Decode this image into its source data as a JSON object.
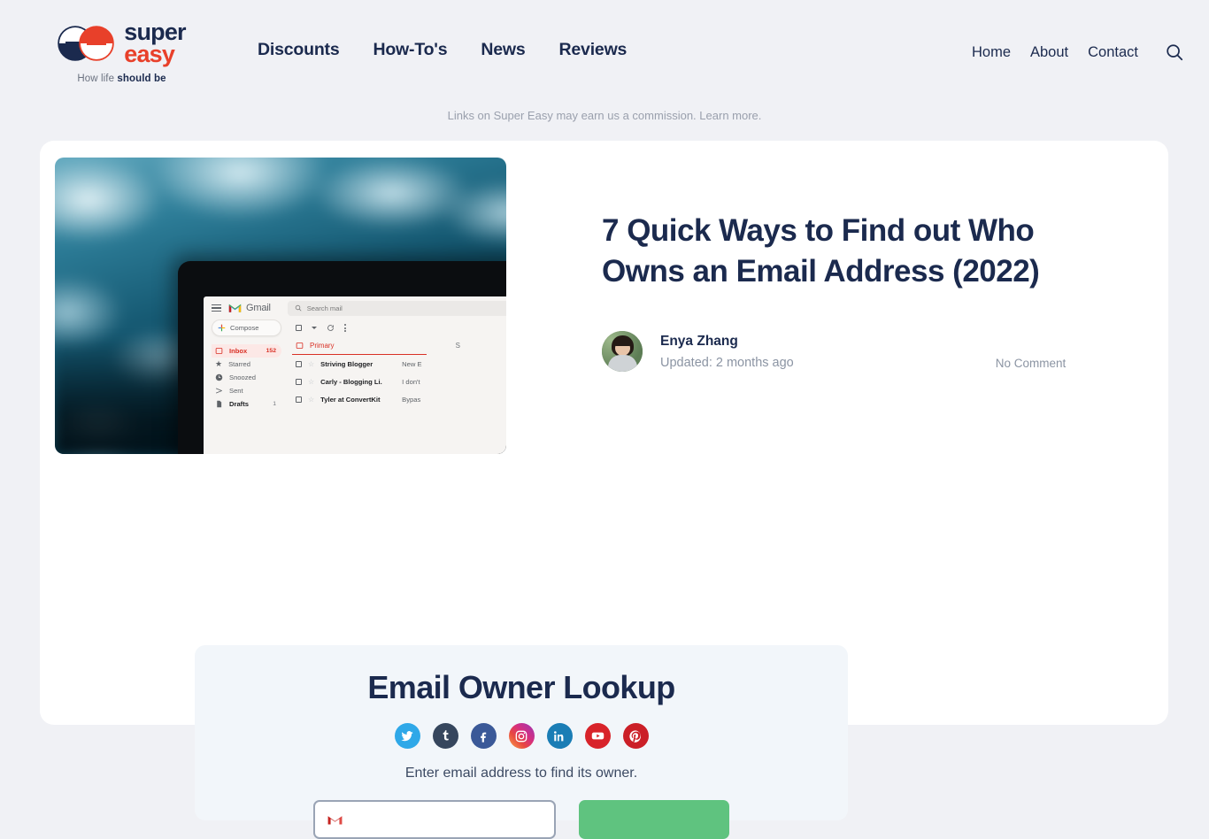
{
  "brand": {
    "name_line1": "super",
    "name_line2": "easy",
    "tagline_light": "How life ",
    "tagline_bold": "should be"
  },
  "nav": {
    "primary": [
      {
        "label": "Discounts"
      },
      {
        "label": "How-To's"
      },
      {
        "label": "News"
      },
      {
        "label": "Reviews"
      }
    ],
    "secondary": [
      {
        "label": "Home"
      },
      {
        "label": "About"
      },
      {
        "label": "Contact"
      }
    ],
    "search_icon": "search-icon"
  },
  "disclaimer": {
    "text": "Links on Super Easy may earn us a commission.",
    "link": "Learn more."
  },
  "article": {
    "title": "7 Quick Ways to Find out Who Owns an Email Address (2022)",
    "author": "Enya Zhang",
    "updated": "Updated: 2 months ago",
    "comments": "No Comment"
  },
  "hero": {
    "alt": "tablet displaying Gmail inbox on blurred ocean background",
    "gmail": {
      "brand": "Gmail",
      "search_placeholder": "Search mail",
      "compose": "Compose",
      "folders": [
        {
          "label": "Inbox",
          "count": "152",
          "active": true
        },
        {
          "label": "Starred",
          "count": "",
          "active": false
        },
        {
          "label": "Snoozed",
          "count": "",
          "active": false
        },
        {
          "label": "Sent",
          "count": "",
          "active": false
        },
        {
          "label": "Drafts",
          "count": "1",
          "active": false
        }
      ],
      "tab": "Primary",
      "tab_secondary": "S",
      "rows": [
        {
          "sender": "Striving Blogger",
          "preview": "New E"
        },
        {
          "sender": "Carly - Blogging Li.",
          "preview": "I don't"
        },
        {
          "sender": "Tyler at ConvertKit",
          "preview": "Bypas"
        }
      ]
    }
  },
  "lookup": {
    "title": "Email Owner Lookup",
    "subtitle": "Enter email address to find its owner.",
    "socials": [
      {
        "name": "twitter",
        "glyph": "ᴠ",
        "color": "#2fa8e8"
      },
      {
        "name": "tumblr",
        "glyph": "t",
        "color": "#36465d"
      },
      {
        "name": "facebook",
        "glyph": "f",
        "color": "#3b5998"
      },
      {
        "name": "instagram",
        "glyph": "□",
        "color": "#d62f7f"
      },
      {
        "name": "linkedin",
        "glyph": "in",
        "color": "#1a7db5"
      },
      {
        "name": "youtube",
        "glyph": "▶",
        "color": "#d8232a"
      },
      {
        "name": "pinterest",
        "glyph": "P",
        "color": "#cb1f27"
      }
    ],
    "input_placeholder": "",
    "input_value": "",
    "button_label": ""
  },
  "colors": {
    "page_bg": "#f0f1f5",
    "card_bg": "#ffffff",
    "navy": "#1b2a4e",
    "brand_red": "#e8402a",
    "panel_bg": "#f2f6fa",
    "button_green": "#5fc37f",
    "muted": "#8b94a3"
  }
}
